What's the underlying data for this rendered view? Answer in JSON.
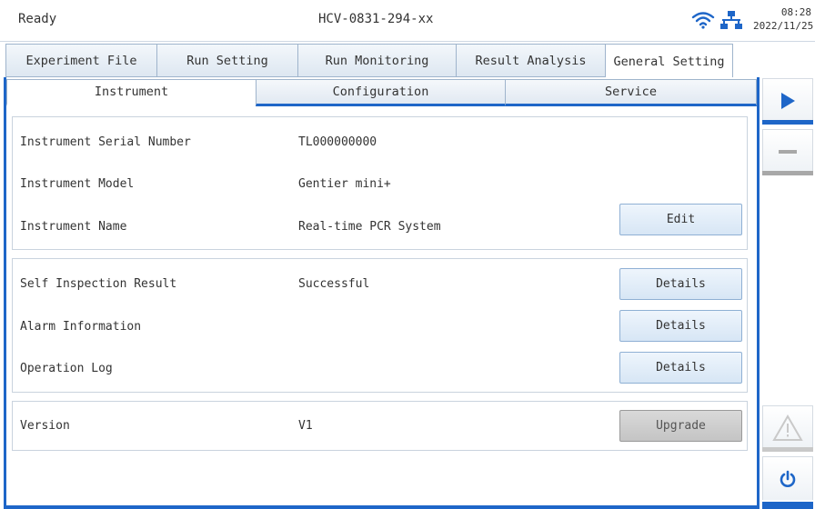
{
  "titlebar": {
    "status": "Ready",
    "device_id": "HCV-0831-294-xx",
    "time": "08:28",
    "date": "2022/11/25",
    "wifi_icon": "wifi-icon",
    "network_icon": "network-icon"
  },
  "main_tabs": [
    {
      "label": "Experiment File"
    },
    {
      "label": "Run Setting"
    },
    {
      "label": "Run Monitoring"
    },
    {
      "label": "Result Analysis"
    },
    {
      "label": "General Setting",
      "active": true
    }
  ],
  "sub_tabs": [
    {
      "label": "Instrument",
      "active": true
    },
    {
      "label": "Configuration"
    },
    {
      "label": "Service"
    }
  ],
  "instrument_info": {
    "serial_label": "Instrument Serial Number",
    "serial_value": "TL000000000",
    "model_label": "Instrument Model",
    "model_value": "Gentier mini+",
    "name_label": "Instrument Name",
    "name_value": "Real-time PCR System",
    "edit_button": "Edit"
  },
  "diagnostics": {
    "self_inspection_label": "Self Inspection Result",
    "self_inspection_value": "Successful",
    "alarm_label": "Alarm Information",
    "operation_log_label": "Operation Log",
    "details_button": "Details"
  },
  "version": {
    "label": "Version",
    "value": "V1",
    "upgrade_button": "Upgrade"
  },
  "colors": {
    "accent": "#1e66c8",
    "panel_border": "#c9d3de",
    "button_bg": "#d7e6f5",
    "button_disabled": "#c4c4c4"
  },
  "rail_icons": [
    "play-icon",
    "stop-icon",
    "warning-icon",
    "power-icon"
  ]
}
